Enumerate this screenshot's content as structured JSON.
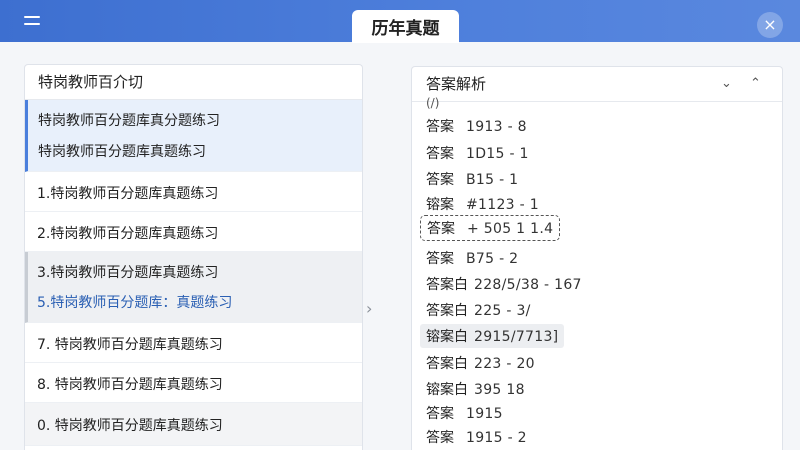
{
  "header": {
    "title": "历年真题",
    "close_label": "×"
  },
  "left_panel": {
    "header": "特岗教师百介切",
    "items": [
      {
        "lines": [
          "特岗教师百分题库真分题练习",
          "特岗教师百分题库真题练习"
        ],
        "style": "active"
      },
      {
        "lines": [
          "1.特岗教师百分题库真题练习"
        ],
        "style": "plain"
      },
      {
        "lines": [
          "2.特岗教师百分题库真题练习"
        ],
        "style": "plain"
      },
      {
        "lines": [
          "3.特岗教师百分题库真题练习",
          "5.特岗教师百分题库：真题练习"
        ],
        "style": "gray"
      },
      {
        "lines": [
          "7. 特岗教师百分题库真题练习"
        ],
        "style": "plain"
      },
      {
        "lines": [
          "8. 特岗教师百分题库真题练习"
        ],
        "style": "plain"
      },
      {
        "lines": [
          "0. 特岗教师百分题库真题练习"
        ],
        "style": "light"
      }
    ]
  },
  "splitter_icon": "chevron-right-icon",
  "right_panel": {
    "header": "答案解析",
    "collapse_icon": "chevron-down-icon",
    "expand_icon": "chevron-up-icon",
    "partial_top": "(/)",
    "answers": [
      {
        "label": "答案",
        "value": "1913 - 8"
      },
      {
        "label": "答案",
        "value": "1D15 - 1"
      },
      {
        "label": "答案",
        "value": "B15 - 1"
      },
      {
        "label": "镕案",
        "value": "#1123 - 1"
      },
      {
        "label": "答案",
        "value": "+ 505 1 1.4"
      },
      {
        "label": "答案",
        "value": "B75 - 2"
      },
      {
        "label": "答案白",
        "value": "228/5/38 - 167"
      },
      {
        "label": "答案白",
        "value": "225 - 3/"
      },
      {
        "label": "镕案白",
        "value": "2915/7713]"
      },
      {
        "label": "答案白",
        "value": "223 - 20"
      },
      {
        "label": "镕案白",
        "value": "395 18"
      },
      {
        "label": "答案",
        "value": "1915"
      },
      {
        "label": "答案",
        "value": "1915 - 2"
      }
    ]
  }
}
